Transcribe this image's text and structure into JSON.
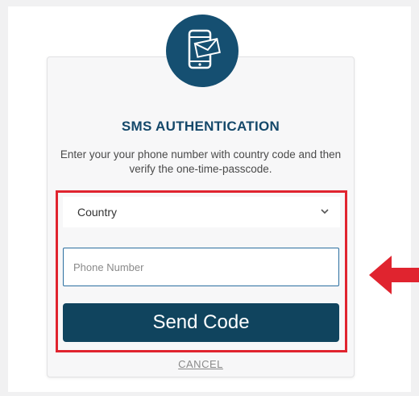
{
  "header": {
    "icon": "phone-message-icon",
    "title": "SMS AUTHENTICATION",
    "description": "Enter your your phone number with country code and then verify the one-time-passcode."
  },
  "form": {
    "country_label": "Country",
    "country_chevron_icon": "chevron-down-icon",
    "phone_value": "",
    "phone_placeholder": "Phone Number",
    "send_button_label": "Send Code",
    "cancel_label": "CANCEL"
  },
  "annotation": {
    "highlight_color": "#e0242f",
    "arrow_icon": "left-arrow-icon",
    "arrow_color": "#e0242f"
  },
  "colors": {
    "brand": "#154f71",
    "button": "#10445e",
    "title": "#14486a"
  }
}
